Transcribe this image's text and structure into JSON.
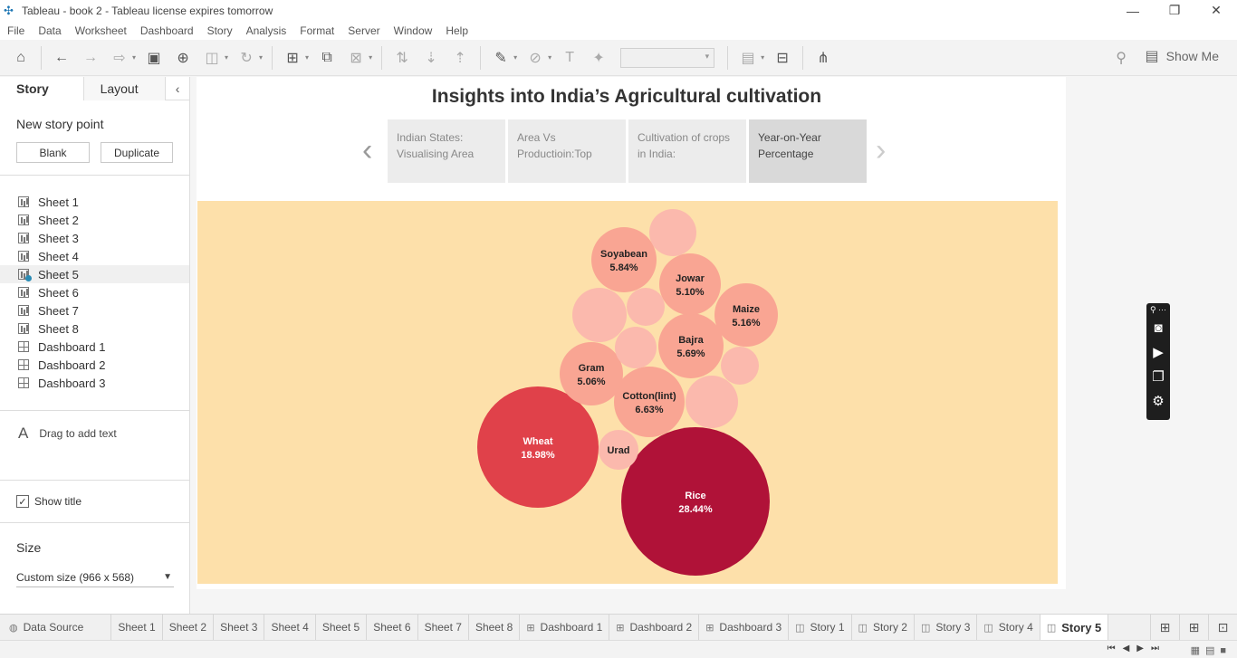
{
  "window": {
    "title": "Tableau - book 2 - Tableau license expires tomorrow",
    "controls": [
      "—",
      "❐",
      "✕"
    ]
  },
  "menu": [
    "File",
    "Data",
    "Worksheet",
    "Dashboard",
    "Story",
    "Analysis",
    "Format",
    "Server",
    "Window",
    "Help"
  ],
  "toolbar": {
    "show_me": "Show Me"
  },
  "left_panel": {
    "tabs": [
      "Story",
      "Layout"
    ],
    "new_story_point": "New story point",
    "blank_button": "Blank",
    "duplicate_button": "Duplicate",
    "sheets": [
      {
        "label": "Sheet 1",
        "type": "sheet"
      },
      {
        "label": "Sheet 2",
        "type": "sheet"
      },
      {
        "label": "Sheet 3",
        "type": "sheet"
      },
      {
        "label": "Sheet 4",
        "type": "sheet"
      },
      {
        "label": "Sheet 5",
        "type": "sheet"
      },
      {
        "label": "Sheet 6",
        "type": "sheet"
      },
      {
        "label": "Sheet 7",
        "type": "sheet"
      },
      {
        "label": "Sheet 8",
        "type": "sheet"
      },
      {
        "label": "Dashboard 1",
        "type": "dashboard"
      },
      {
        "label": "Dashboard 2",
        "type": "dashboard"
      },
      {
        "label": "Dashboard 3",
        "type": "dashboard"
      }
    ],
    "drag_text": "Drag to add text",
    "show_title": "Show title",
    "show_title_checked": true,
    "size_label": "Size",
    "size_value": "Custom size (966 x 568)"
  },
  "story": {
    "title": "Insights into India’s Agricultural cultivation",
    "points": [
      {
        "line1": "Indian States:",
        "line2": "Visualising Area"
      },
      {
        "line1": "Area Vs",
        "line2": "Productioin:Top"
      },
      {
        "line1": "Cultivation of crops",
        "line2": "in India:"
      },
      {
        "line1": "Year-on-Year",
        "line2": "Percentage"
      }
    ],
    "active_point": 3
  },
  "chart_data": {
    "type": "packed-bubble",
    "measure": "percentage",
    "background": "#fde0aa",
    "bubbles": [
      {
        "label": "Rice",
        "value": 28.44,
        "display": "28.44%",
        "color": "#b01238"
      },
      {
        "label": "Wheat",
        "value": 18.98,
        "display": "18.98%",
        "color": "#e0414a"
      },
      {
        "label": "Cotton(lint)",
        "value": 6.63,
        "display": "6.63%",
        "color": "#f9a593"
      },
      {
        "label": "Soyabean",
        "value": 5.84,
        "display": "5.84%",
        "color": "#f9a593"
      },
      {
        "label": "Bajra",
        "value": 5.69,
        "display": "5.69%",
        "color": "#f9a593"
      },
      {
        "label": "Maize",
        "value": 5.16,
        "display": "5.16%",
        "color": "#f9a593"
      },
      {
        "label": "Jowar",
        "value": 5.1,
        "display": "5.10%",
        "color": "#f9a593"
      },
      {
        "label": "Gram",
        "value": 5.06,
        "display": "5.06%",
        "color": "#f9a593"
      },
      {
        "label": "Urad",
        "value": null,
        "display": "",
        "color": "#fbb9ad"
      },
      {
        "label": "",
        "value": null,
        "display": "",
        "color": "#fbb9ad"
      },
      {
        "label": "",
        "value": null,
        "display": "",
        "color": "#fbb9ad"
      },
      {
        "label": "",
        "value": null,
        "display": "",
        "color": "#fbb9ad"
      },
      {
        "label": "",
        "value": null,
        "display": "",
        "color": "#fbb9ad"
      },
      {
        "label": "",
        "value": null,
        "display": "",
        "color": "#fbb9ad"
      },
      {
        "label": "",
        "value": null,
        "display": "",
        "color": "#fbb9ad"
      }
    ]
  },
  "bottom_tabs": [
    {
      "label": "Data Source",
      "icon": "database-icon"
    },
    {
      "label": "Sheet 1",
      "icon": ""
    },
    {
      "label": "Sheet 2",
      "icon": ""
    },
    {
      "label": "Sheet 3",
      "icon": ""
    },
    {
      "label": "Sheet 4",
      "icon": ""
    },
    {
      "label": "Sheet 5",
      "icon": ""
    },
    {
      "label": "Sheet 6",
      "icon": ""
    },
    {
      "label": "Sheet 7",
      "icon": ""
    },
    {
      "label": "Sheet 8",
      "icon": ""
    },
    {
      "label": "Dashboard 1",
      "icon": "dashboard-icon"
    },
    {
      "label": "Dashboard 2",
      "icon": "dashboard-icon"
    },
    {
      "label": "Dashboard 3",
      "icon": "dashboard-icon"
    },
    {
      "label": "Story 1",
      "icon": "story-icon"
    },
    {
      "label": "Story 2",
      "icon": "story-icon"
    },
    {
      "label": "Story 3",
      "icon": "story-icon"
    },
    {
      "label": "Story 4",
      "icon": "story-icon"
    },
    {
      "label": "Story 5",
      "icon": "story-icon",
      "active": true
    }
  ]
}
